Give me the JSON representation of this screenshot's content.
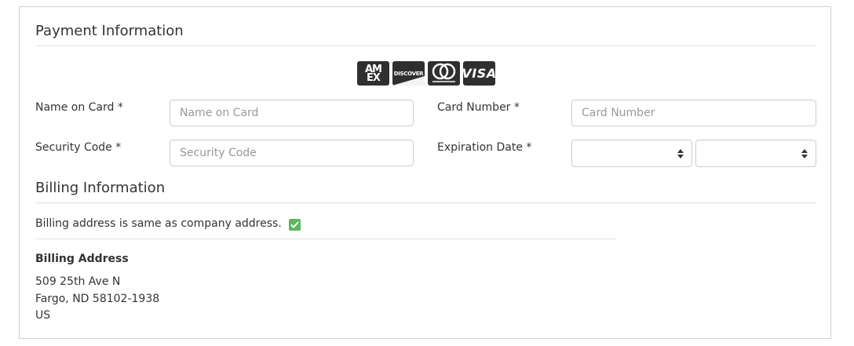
{
  "payment": {
    "title": "Payment Information",
    "card_logos": [
      "AMEX",
      "DISCOVER",
      "mastercard",
      "VISA"
    ],
    "name_on_card": {
      "label": "Name on Card *",
      "placeholder": "Name on Card",
      "value": ""
    },
    "card_number": {
      "label": "Card Number *",
      "placeholder": "Card Number",
      "value": ""
    },
    "security_code": {
      "label": "Security Code *",
      "placeholder": "Security Code",
      "value": ""
    },
    "expiration": {
      "label": "Expiration Date *",
      "month": "",
      "year": ""
    }
  },
  "billing": {
    "title": "Billing Information",
    "same_as_company_label": "Billing address is same as company address.",
    "same_as_company_checked": true,
    "address_title": "Billing Address",
    "address_lines": [
      "509 25th Ave N",
      "Fargo, ND 58102-1938",
      "US"
    ]
  },
  "colors": {
    "checkbox": "#5cb85c",
    "card_logo_bg": "#2f2f2f"
  }
}
